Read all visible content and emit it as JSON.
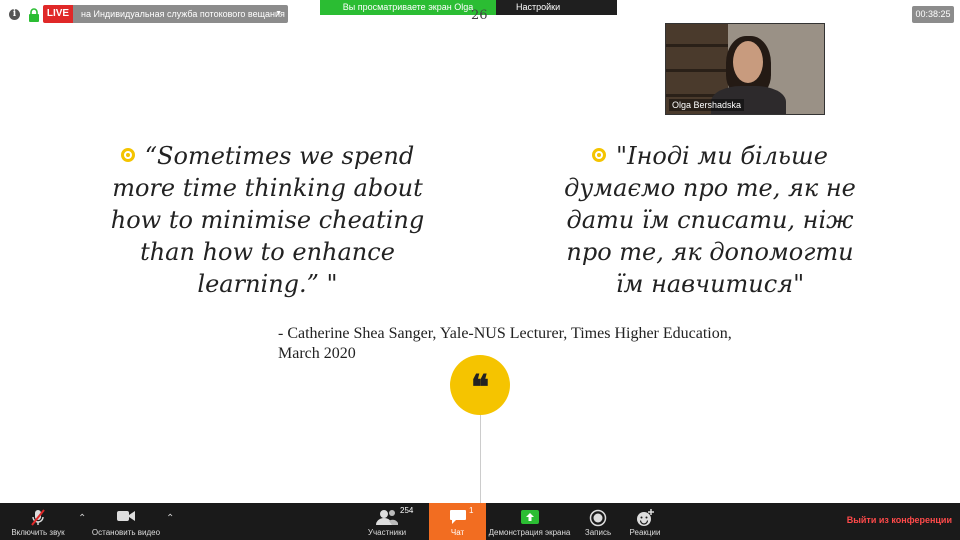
{
  "topbar": {
    "live_label": "LIVE",
    "stream_label": "на Индивидуальная служба потокового вещания",
    "share_status": "Вы просматриваете экран Olga Bershadska",
    "view_settings_label": "Настройки просмотра",
    "timer": "00:38:25"
  },
  "slide": {
    "page_number": "26",
    "quote_en": "“Sometimes we spend more time thinking about how to minimise cheating than how to enhance learning.” \"",
    "quote_uk": "\"Іноді ми більше думаємо про те, як не дати їм списати, ніж про те, як допомогти їм навчитися\"",
    "attribution": "- Catherine Shea Sanger, Yale-NUS Lecturer, Times Higher Education, March 2020",
    "quote_mark": "❝",
    "accent_color": "#f5c400"
  },
  "video": {
    "participant_name": "Olga Bershadska"
  },
  "toolbar": {
    "unmute_label": "Включить звук",
    "stop_video_label": "Остановить видео",
    "participants_label": "Участники",
    "participants_count": "254",
    "chat_label": "Чат",
    "chat_count": "1",
    "share_label": "Демонстрация экрана",
    "record_label": "Запись",
    "reactions_label": "Реакции",
    "leave_label": "Выйти из конференции"
  }
}
